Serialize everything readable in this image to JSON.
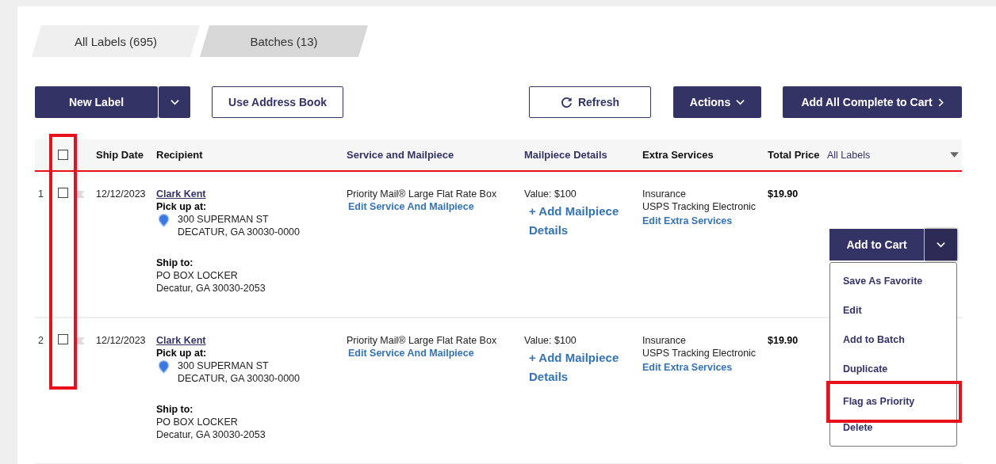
{
  "tabs": [
    {
      "label": "All Labels (695)",
      "selected": true
    },
    {
      "label": "Batches (13)",
      "selected": false
    }
  ],
  "toolbar": [
    {
      "kind": "split",
      "label": "New Label"
    },
    {
      "kind": "outline",
      "label": "Use Address Book"
    },
    {
      "kind": "refresh",
      "label": "Refresh"
    },
    {
      "kind": "dropdown",
      "label": "Actions"
    },
    {
      "kind": "next",
      "label": "Add All Complete to Cart"
    }
  ],
  "table": {
    "select_all_checked": false,
    "checkbox_column_highlighted": true,
    "filter": "All Labels",
    "columns": [
      {
        "label": "Ship Date",
        "accent": false
      },
      {
        "label": "Recipient",
        "accent": false
      },
      {
        "label": "Service and Mailpiece",
        "accent": true
      },
      {
        "label": "Mailpiece Details",
        "accent": true
      },
      {
        "label": "Extra Services",
        "accent": false
      },
      {
        "label": "Total Price",
        "accent": false
      }
    ],
    "rows": [
      {
        "number": "1",
        "checked": false,
        "flagged": false,
        "ship_date": "12/12/2023",
        "recipient": "Clark Kent",
        "pickup_label": "Pick up at:",
        "pickup_lines": [
          "300 SUPERMAN ST",
          "DECATUR, GA 30030-0000"
        ],
        "shipto_label": "Ship to:",
        "shipto_lines": [
          "PO BOX LOCKER",
          "Decatur, GA 30030-2053"
        ],
        "service": "Priority Mail® Large Flat Rate Box",
        "service_link": "Edit Service And Mailpiece",
        "value": "Value: $100",
        "details_link": "+ Add Mailpiece Details",
        "extras": [
          "Insurance",
          "USPS Tracking Electronic"
        ],
        "extras_link": "Edit Extra Services",
        "total": "$19.90"
      },
      {
        "number": "2",
        "checked": false,
        "flagged": false,
        "ship_date": "12/12/2023",
        "recipient": "Clark Kent",
        "pickup_label": "Pick up at:",
        "pickup_lines": [
          "300 SUPERMAN ST",
          "DECATUR, GA 30030-0000"
        ],
        "shipto_label": "Ship to:",
        "shipto_lines": [
          "PO BOX LOCKER",
          "Decatur, GA 30030-2053"
        ],
        "service": "Priority Mail® Large Flat Rate Box",
        "service_link": "Edit Service And Mailpiece",
        "value": "Value: $100",
        "details_link": "+ Add Mailpiece Details",
        "extras": [
          "Insurance",
          "USPS Tracking Electronic"
        ],
        "extras_link": "Edit Extra Services",
        "total": "$19.90"
      }
    ]
  },
  "cart_button": {
    "label": "Add to Cart",
    "menu_open": true,
    "menu": [
      {
        "label": "Save As Favorite",
        "highlighted": false
      },
      {
        "label": "Edit",
        "highlighted": false
      },
      {
        "label": "Add to Batch",
        "highlighted": false
      },
      {
        "label": "Duplicate",
        "highlighted": false
      },
      {
        "label": "Flag as Priority",
        "highlighted": true
      },
      {
        "label": "Delete",
        "highlighted": false
      }
    ]
  }
}
